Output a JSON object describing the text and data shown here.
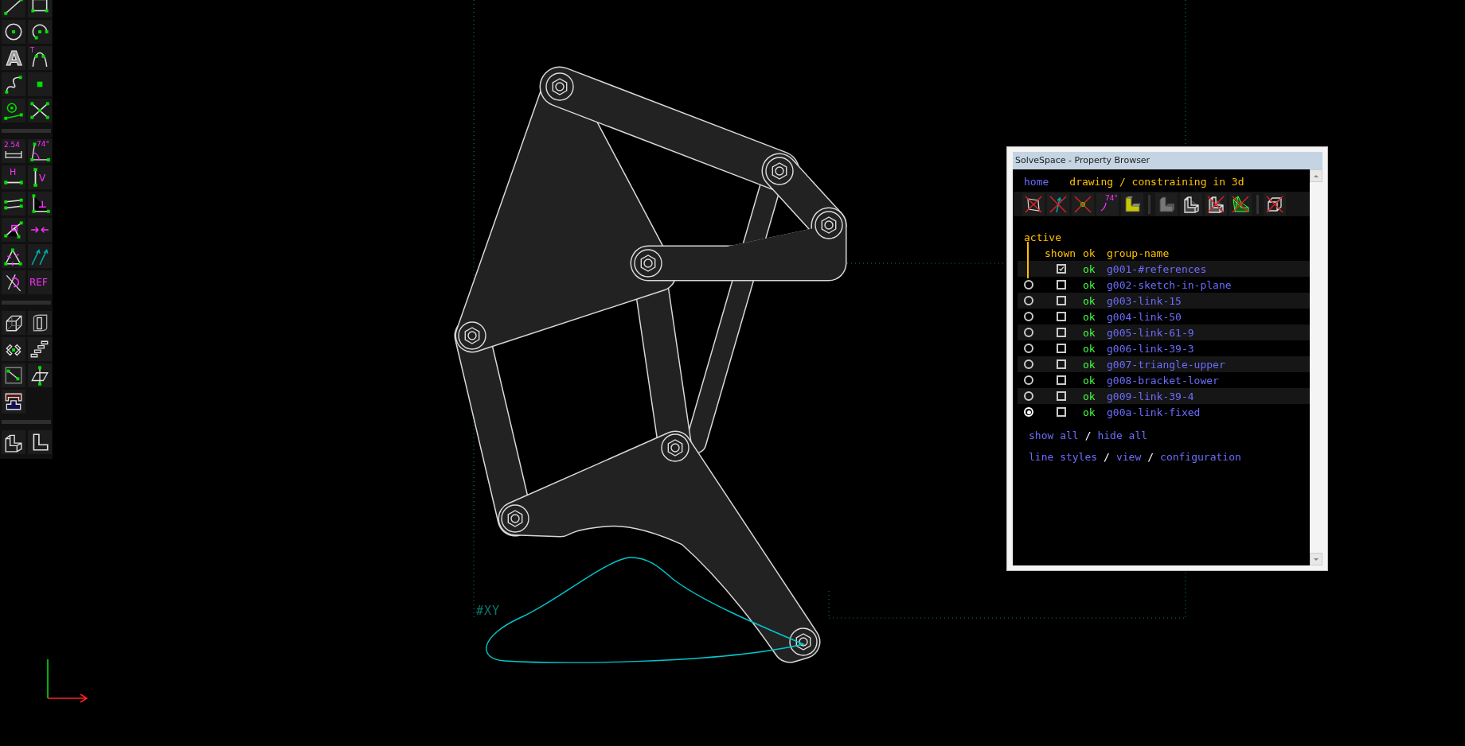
{
  "toolbar": {
    "sections": [
      [
        {
          "kind": "line"
        },
        {
          "kind": "rectangle"
        },
        {
          "kind": "circle"
        },
        {
          "kind": "arc"
        },
        {
          "kind": "text",
          "label": "A"
        },
        {
          "kind": "tangent-arc",
          "label": "T"
        },
        {
          "kind": "bezier"
        },
        {
          "kind": "point"
        },
        {
          "kind": "workplane"
        },
        {
          "kind": "split"
        }
      ],
      [
        {
          "kind": "distance",
          "label": "2.54"
        },
        {
          "kind": "angle",
          "label": "74°"
        },
        {
          "kind": "horizontal",
          "label": "H"
        },
        {
          "kind": "vertical",
          "label": "V"
        },
        {
          "kind": "parallel"
        },
        {
          "kind": "perpendicular"
        },
        {
          "kind": "on-point"
        },
        {
          "kind": "symmetric"
        },
        {
          "kind": "equal"
        },
        {
          "kind": "tangent"
        },
        {
          "kind": "construction"
        },
        {
          "kind": "reference",
          "label": "REF"
        }
      ],
      [
        {
          "kind": "extrude"
        },
        {
          "kind": "lathe"
        },
        {
          "kind": "step-rotate"
        },
        {
          "kind": "step-translate"
        },
        {
          "kind": "new-workplane"
        },
        {
          "kind": "plane"
        },
        {
          "kind": "import"
        }
      ],
      [
        {
          "kind": "iso"
        },
        {
          "kind": "ortho"
        }
      ]
    ]
  },
  "canvas": {
    "workplane_label": "#XY"
  },
  "browser": {
    "window": {
      "title": "SolveSpace - Property Browser"
    },
    "nav": {
      "home": "home",
      "heading": "drawing / constraining in 3d"
    },
    "view_toolbar": [
      {
        "kind": "workplanes",
        "on": false
      },
      {
        "kind": "normals",
        "on": false
      },
      {
        "kind": "points",
        "on": false
      },
      {
        "kind": "constraints",
        "on": true,
        "label": "74°"
      },
      {
        "kind": "faces",
        "on": true
      },
      {
        "kind": "separator"
      },
      {
        "kind": "shaded",
        "on": true
      },
      {
        "kind": "edges",
        "on": true
      },
      {
        "kind": "hidden-lines",
        "on": false
      },
      {
        "kind": "mesh",
        "on": false
      },
      {
        "kind": "separator"
      },
      {
        "kind": "bounding-box",
        "on": false
      }
    ],
    "columns": {
      "active": "active",
      "shown": "shown",
      "ok": "ok",
      "name": "group-name"
    },
    "groups": [
      {
        "kind": "reference",
        "shown": true,
        "status": "ok",
        "name": "g001-#references"
      },
      {
        "kind": "group",
        "selected": false,
        "shown": false,
        "status": "ok",
        "name": "g002-sketch-in-plane"
      },
      {
        "kind": "group",
        "selected": false,
        "shown": false,
        "status": "ok",
        "name": "g003-link-15"
      },
      {
        "kind": "group",
        "selected": false,
        "shown": false,
        "status": "ok",
        "name": "g004-link-50"
      },
      {
        "kind": "group",
        "selected": false,
        "shown": false,
        "status": "ok",
        "name": "g005-link-61-9"
      },
      {
        "kind": "group",
        "selected": false,
        "shown": false,
        "status": "ok",
        "name": "g006-link-39-3"
      },
      {
        "kind": "group",
        "selected": false,
        "shown": false,
        "status": "ok",
        "name": "g007-triangle-upper"
      },
      {
        "kind": "group",
        "selected": false,
        "shown": false,
        "status": "ok",
        "name": "g008-bracket-lower"
      },
      {
        "kind": "group",
        "selected": false,
        "shown": false,
        "status": "ok",
        "name": "g009-link-39-4"
      },
      {
        "kind": "group",
        "selected": true,
        "shown": false,
        "status": "ok",
        "name": "g00a-link-fixed"
      }
    ],
    "links": {
      "separator": "/",
      "rows": [
        [
          "show all",
          "hide all"
        ],
        [
          "line styles",
          "view",
          "configuration"
        ]
      ]
    }
  }
}
